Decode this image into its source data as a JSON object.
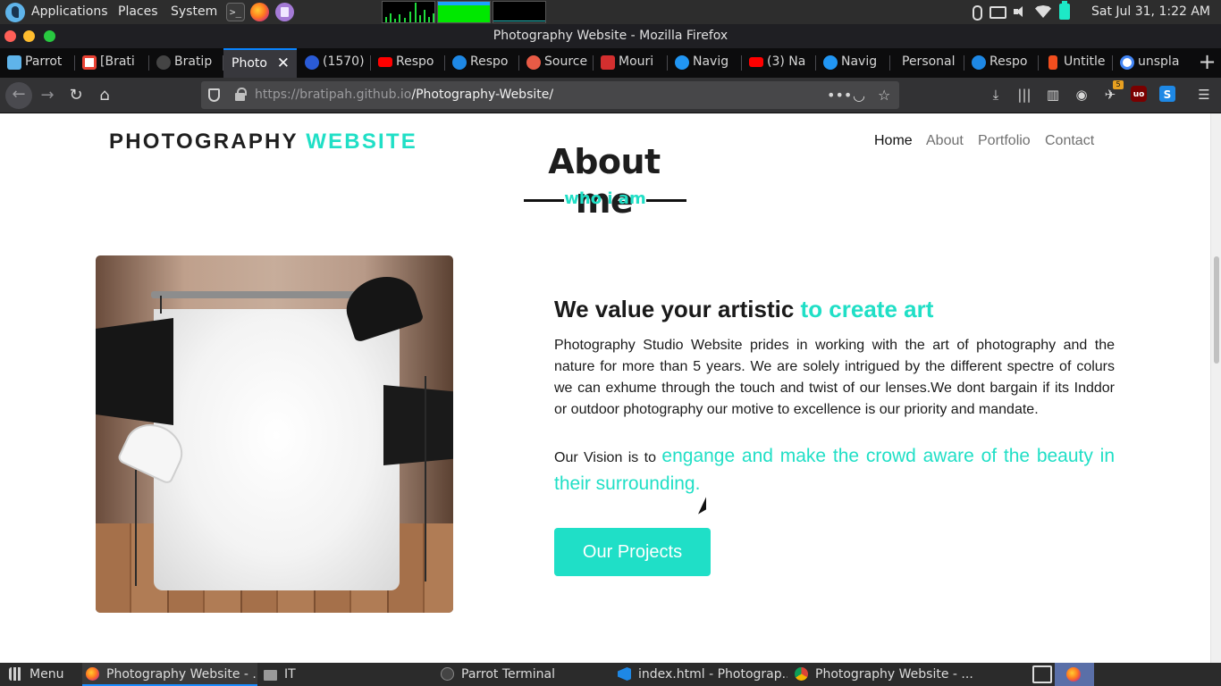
{
  "system_panel": {
    "applications": "Applications",
    "places": "Places",
    "system": "System",
    "clock": "Sat Jul 31,  1:22 AM",
    "quick_launch_icons": [
      "terminal-icon",
      "firefox-icon",
      "text-editor-icon"
    ],
    "tray_icons": [
      "bluetooth-icon",
      "keyboard-icon",
      "volume-icon",
      "wifi-icon",
      "battery-icon"
    ]
  },
  "window": {
    "title": "Photography Website - Mozilla Firefox"
  },
  "tabs": [
    {
      "label": "Parrot",
      "icon": "parrot-icon",
      "color": "#5fb4ea"
    },
    {
      "label": "[Brati",
      "icon": "gmail-icon",
      "color": "#ea4335"
    },
    {
      "label": "Bratip",
      "icon": "github-icon",
      "color": "#333333"
    },
    {
      "label": "Photo",
      "icon": "page-icon",
      "active": true
    },
    {
      "label": "(1570)",
      "icon": "globe-icon",
      "color": "#2a5bd7"
    },
    {
      "label": "Respo",
      "icon": "youtube-icon",
      "color": "#ff0000"
    },
    {
      "label": "Respo",
      "icon": "codenewbie-icon",
      "color": "#1e88e5"
    },
    {
      "label": "Source",
      "icon": "patreon-icon",
      "color": "#e85b46"
    },
    {
      "label": "Mouri",
      "icon": "d-icon",
      "color": "#d32f2f"
    },
    {
      "label": "Navig",
      "icon": "c-icon",
      "color": "#2196f3"
    },
    {
      "label": "(3) Na",
      "icon": "youtube-icon",
      "color": "#ff0000"
    },
    {
      "label": "Navig",
      "icon": "c-icon",
      "color": "#2196f3"
    },
    {
      "label": "Personal",
      "icon": "none"
    },
    {
      "label": "Respo",
      "icon": "codenewbie-icon",
      "color": "#1e88e5"
    },
    {
      "label": "Untitle",
      "icon": "figma-icon",
      "color": "#f24e1e"
    },
    {
      "label": "unspla",
      "icon": "google-icon",
      "color": "#4285f4"
    }
  ],
  "urlbar": {
    "prefix": "https://bratipah.github.io",
    "path": "/Photography-Website/"
  },
  "toolbar": {
    "extension_badge": "5",
    "ublock_label": "uo",
    "s_ext_label": "S"
  },
  "site": {
    "brand": {
      "main": "PHOTOGRAPHY",
      "accent": "WEBSITE"
    },
    "nav": [
      "Home",
      "About",
      "Portfolio",
      "Contact"
    ],
    "about": {
      "title": "About me",
      "subtitle": "who i am",
      "heading_main": "We value your artistic",
      "heading_accent": "to create art",
      "paragraph": "Photography Studio Website prides in working with the art of photography and the nature for more than 5 years. We are solely intrigued by the different spectre of colurs we can exhume through the touch and twist of our lenses.We dont bargain if its Inddor or outdoor photography our motive to excellence is our priority and mandate.",
      "vision_lead": "Our Vision is to",
      "vision_accent": "engange and make the crowd aware of the beauty in their surrounding.",
      "button": "Our Projects"
    },
    "colors": {
      "accent": "#20dfc6",
      "text": "#1a1a1a"
    }
  },
  "taskbar": {
    "menu": "Menu",
    "items": [
      {
        "label": "Photography Website - ...",
        "icon": "firefox-icon",
        "active": true
      },
      {
        "label": "IT",
        "icon": "folder-icon"
      },
      {
        "label": "Parrot Terminal",
        "icon": "terminal-icon"
      },
      {
        "label": "index.html - Photograp...",
        "icon": "vscode-icon"
      },
      {
        "label": "Photography Website - ...",
        "icon": "chrome-icon"
      }
    ]
  }
}
